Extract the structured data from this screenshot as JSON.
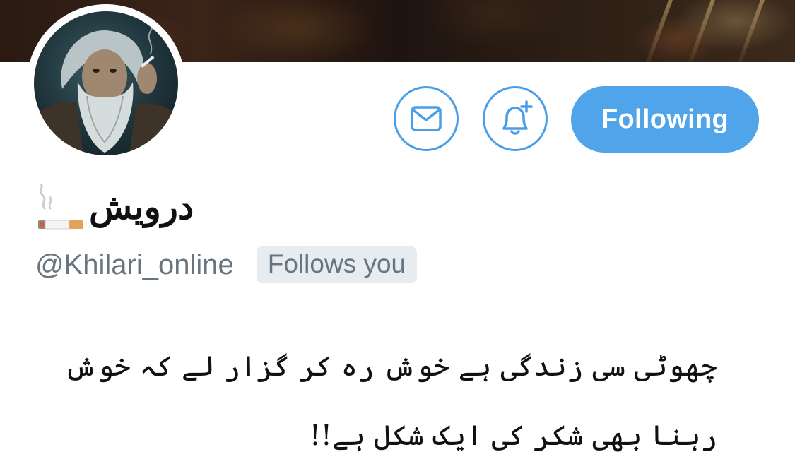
{
  "profile": {
    "display_name": "درویش",
    "handle": "@Khilari_online",
    "follows_you_label": "Follows you",
    "bio": "چھوٹی سی زندگی ہے خوش رہ کر گزار لے کہ خوش رہنا بھی شکر کی ایک شکل ہے!!"
  },
  "actions": {
    "message_icon": "envelope-icon",
    "notify_icon": "bell-plus-icon",
    "following_label": "Following"
  },
  "colors": {
    "accent": "#50a4ea",
    "muted_text": "#66757f",
    "badge_bg": "#e6ecf0"
  },
  "icons": {
    "name_emoji": "cigarette-icon"
  }
}
